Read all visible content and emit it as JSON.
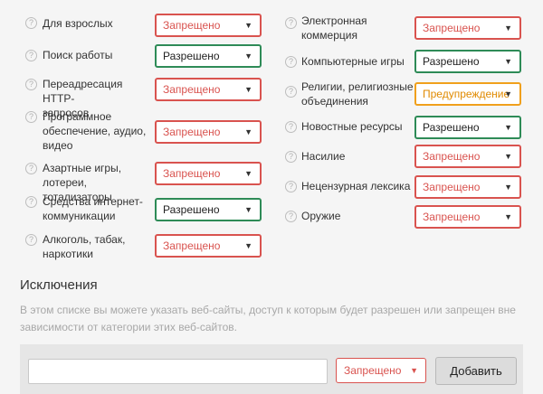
{
  "help_glyph": "?",
  "arrow_glyph": "▼",
  "categories_left": [
    {
      "label": "Для взрослых",
      "value": "Запрещено",
      "status": "blocked"
    },
    {
      "label": "Поиск работы",
      "value": "Разрешено",
      "status": "allowed"
    },
    {
      "label": "Переадресация HTTP-\nзапросов",
      "value": "Запрещено",
      "status": "blocked"
    },
    {
      "label": "Программное\nобеспечение, аудио,\nвидео",
      "value": "Запрещено",
      "status": "blocked"
    },
    {
      "label": "Азартные игры,\nлотереи, тотализаторы",
      "value": "Запрещено",
      "status": "blocked"
    },
    {
      "label": "Средства интернет-\nкоммуникации",
      "value": "Разрешено",
      "status": "allowed"
    },
    {
      "label": "Алкоголь, табак,\nнаркотики",
      "value": "Запрещено",
      "status": "blocked"
    }
  ],
  "categories_right": [
    {
      "label": "Электронная\nкоммерция",
      "value": "Запрещено",
      "status": "blocked"
    },
    {
      "label": "Компьютерные игры",
      "value": "Разрешено",
      "status": "allowed"
    },
    {
      "label": "Религии, религиозные\nобъединения",
      "value": "Предупреждение",
      "status": "warning"
    },
    {
      "label": "Новостные ресурсы",
      "value": "Разрешено",
      "status": "allowed"
    },
    {
      "label": "Насилие",
      "value": "Запрещено",
      "status": "blocked"
    },
    {
      "label": "Нецензурная лексика",
      "value": "Запрещено",
      "status": "blocked"
    },
    {
      "label": "Оружие",
      "value": "Запрещено",
      "status": "blocked"
    }
  ],
  "exceptions": {
    "title": "Исключения",
    "description": "В этом списке вы можете указать веб-сайты, доступ к которым будет разрешен или запрещен вне зависимости от категории этих веб-сайтов.",
    "input_value": "",
    "select_value": "Запрещено",
    "add_button": "Добавить"
  },
  "colors": {
    "blocked": "#d9534f",
    "allowed": "#2e8b57",
    "warning": "#f0a01c"
  }
}
